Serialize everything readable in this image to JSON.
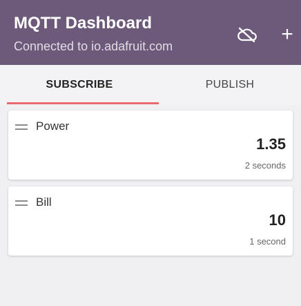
{
  "app": {
    "title": "MQTT Dashboard",
    "subtitle": "Connected to io.adafruit.com",
    "add_label": "+",
    "colors": {
      "appbar": "#6d5a7a",
      "tab_indicator": "#e96a6a",
      "background": "#f0eff1"
    },
    "icons": [
      "cloud-off-icon",
      "add-icon",
      "drag-handle-icon"
    ]
  },
  "tabs": [
    {
      "label": "SUBSCRIBE",
      "selected": true
    },
    {
      "label": "PUBLISH",
      "selected": false
    }
  ],
  "feeds": [
    {
      "name": "Power",
      "value": "1.35",
      "time": "2 seconds"
    },
    {
      "name": "Bill",
      "value": "10",
      "time": "1 second"
    }
  ]
}
